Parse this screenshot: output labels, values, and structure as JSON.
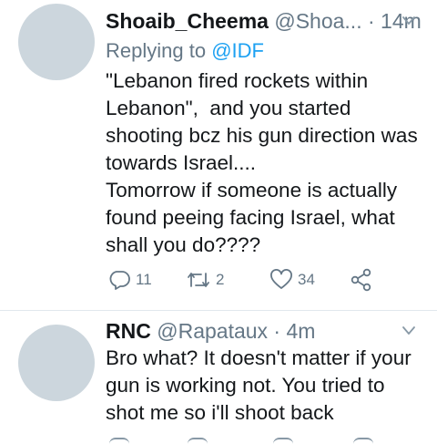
{
  "tweets": [
    {
      "name": "Shoaib_Cheema",
      "handle": "@Shoa...",
      "dot": " · ",
      "time": "14m",
      "replying_prefix": "Replying to ",
      "replying_to": "@IDF",
      "text": "\"Lebanon fired rockets within Lebanon\",  and you started shooting bcz his gun direction was towards Israel....\nTomorrow if someone is actually found peeing facing Israel, what shall you do????",
      "replies": "11",
      "retweets": "2",
      "likes": "34"
    },
    {
      "name": "RNC",
      "handle": "@Rapataux",
      "dot": " · ",
      "time": "4m",
      "text": "Bro what? It doesn't matter if your gun is working not. You tried to shot me so i'll shoot back"
    }
  ],
  "icons": {
    "reply": "reply-icon",
    "retweet": "retweet-icon",
    "like": "heart-icon",
    "share": "share-icon",
    "menu": "chevron-down-icon"
  },
  "colors": {
    "link": "#1da1f2",
    "muted": "#657786",
    "avatar_placeholder": "#ccd6dd",
    "divider": "#e1e8ed"
  }
}
